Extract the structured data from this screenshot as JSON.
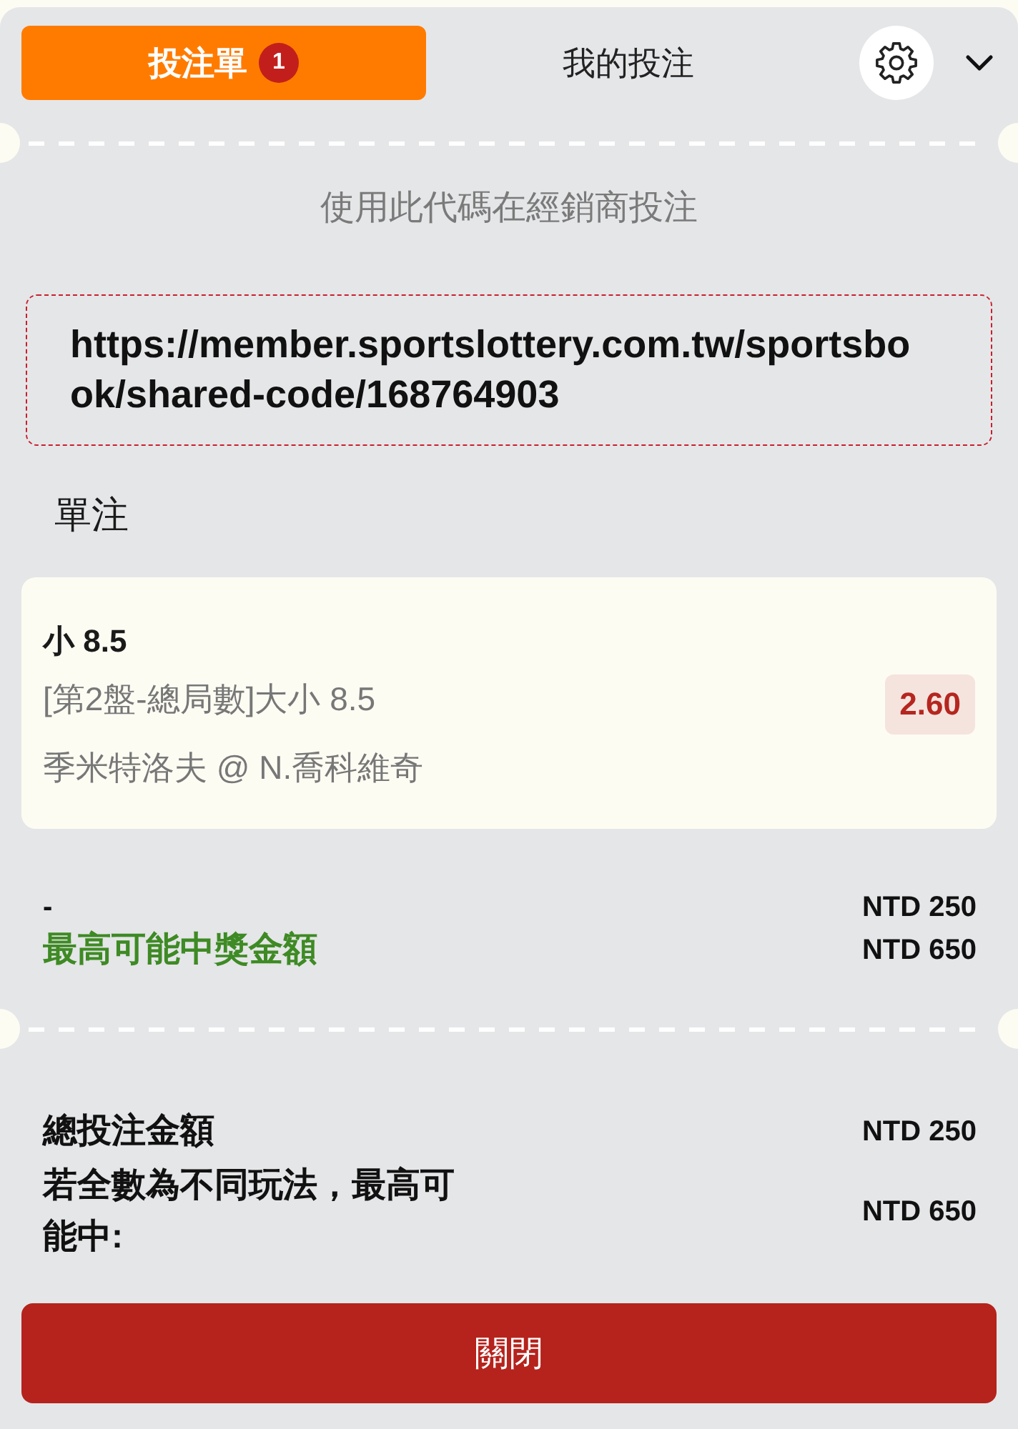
{
  "tabs": [
    {
      "label": "投注單",
      "selected": true,
      "badge": "1"
    },
    {
      "label": "我的投注",
      "selected": false
    }
  ],
  "share": {
    "instruction": "使用此代碼在經銷商投注",
    "code_url": "https://member.sportslottery.com.tw/sportsbook/shared-code/168764903"
  },
  "section_title": "單注",
  "bets": [
    {
      "selection": "小 8.5",
      "market": "[第2盤-總局數]大小 8.5",
      "match": "季米特洛夫 @ N.喬科維奇",
      "odds": "2.60"
    }
  ],
  "stake_rows": [
    {
      "kind": "plain",
      "label": "-",
      "amount": "NTD 250"
    },
    {
      "kind": "payout",
      "label": "最高可能中獎金額",
      "amount": "NTD 650"
    }
  ],
  "summary_rows": [
    {
      "label": "總投注金額",
      "amount": "NTD 250"
    },
    {
      "label": "若全數為不同玩法，最高可能中:",
      "amount": "NTD 650"
    }
  ],
  "close_button": "關閉"
}
